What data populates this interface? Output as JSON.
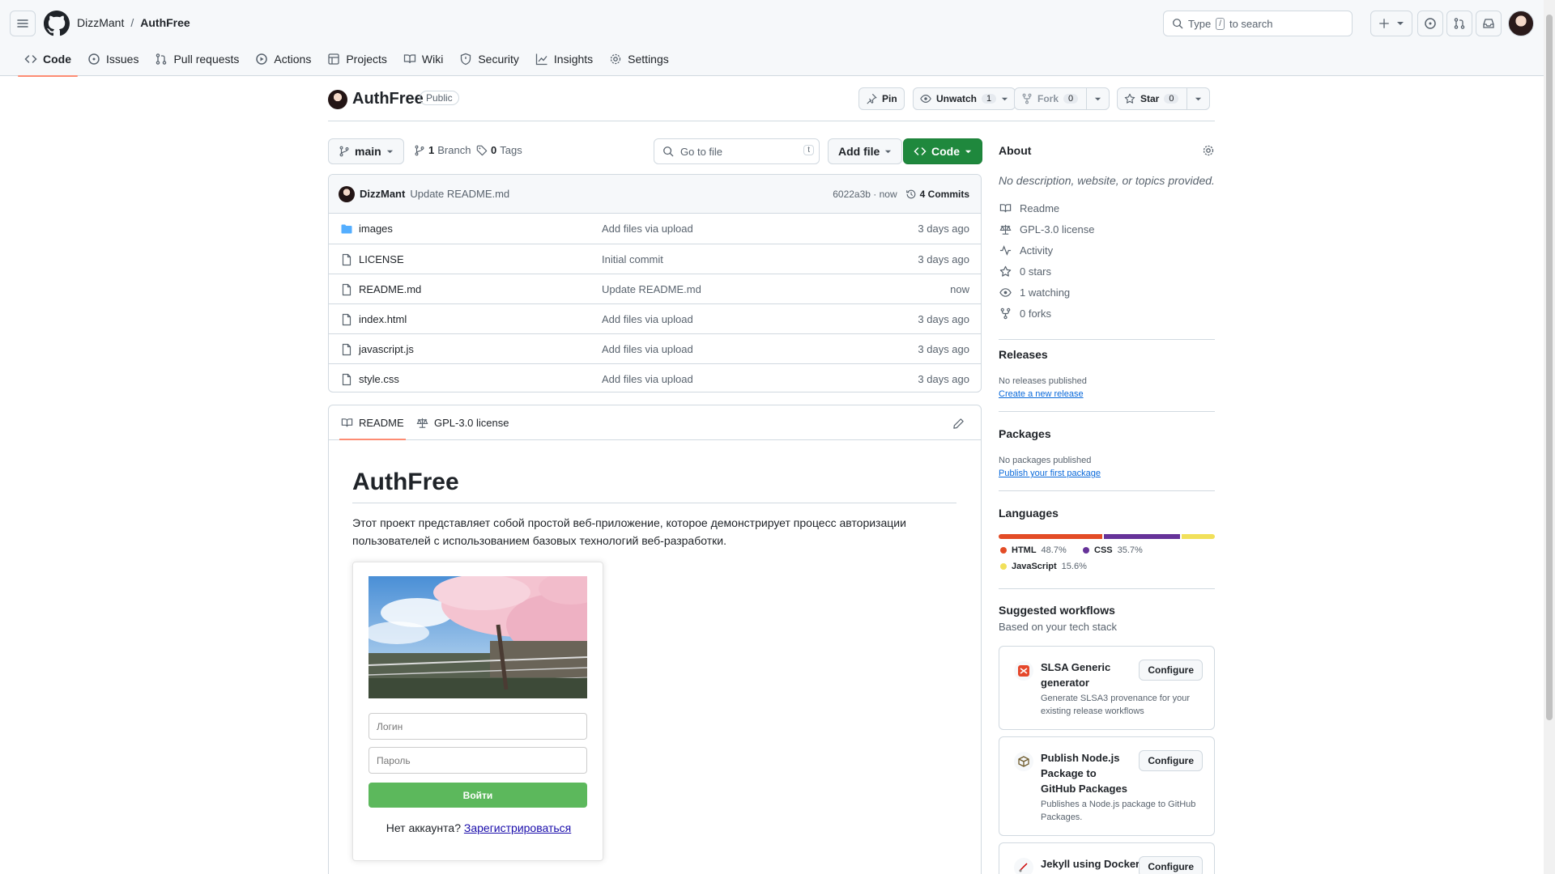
{
  "header": {
    "owner": "DizzMant",
    "separator": "/",
    "repo": "AuthFree",
    "search_prefix": "Type",
    "search_key": "/",
    "search_suffix": "to search"
  },
  "repo_tabs": [
    {
      "label": "Code",
      "icon": "code-icon"
    },
    {
      "label": "Issues",
      "icon": "issue-icon"
    },
    {
      "label": "Pull requests",
      "icon": "pull-request-icon"
    },
    {
      "label": "Actions",
      "icon": "play-icon"
    },
    {
      "label": "Projects",
      "icon": "table-icon"
    },
    {
      "label": "Wiki",
      "icon": "book-icon"
    },
    {
      "label": "Security",
      "icon": "shield-icon"
    },
    {
      "label": "Insights",
      "icon": "graph-icon"
    },
    {
      "label": "Settings",
      "icon": "gear-icon"
    }
  ],
  "repo_header": {
    "name": "AuthFree",
    "visibility": "Public",
    "pin": "Pin",
    "unwatch": "Unwatch",
    "watch_count": "1",
    "fork": "Fork",
    "fork_count": "0",
    "star": "Star",
    "star_count": "0"
  },
  "toolbar": {
    "branch": "main",
    "branches_count": "1",
    "branches_label": "Branch",
    "tags_count": "0",
    "tags_label": "Tags",
    "goto_placeholder": "Go to file",
    "goto_key": "t",
    "add_file": "Add file",
    "code": "Code"
  },
  "latest_commit": {
    "author": "DizzMant",
    "message": "Update README.md",
    "hash_time": "6022a3b · now",
    "commits": "4 Commits"
  },
  "files": [
    {
      "name": "images",
      "type": "folder",
      "message": "Add files via upload",
      "time": "3 days ago"
    },
    {
      "name": "LICENSE",
      "type": "file",
      "message": "Initial commit",
      "time": "3 days ago"
    },
    {
      "name": "README.md",
      "type": "file",
      "message": "Update README.md",
      "time": "now"
    },
    {
      "name": "index.html",
      "type": "file",
      "message": "Add files via upload",
      "time": "3 days ago"
    },
    {
      "name": "javascript.js",
      "type": "file",
      "message": "Add files via upload",
      "time": "3 days ago"
    },
    {
      "name": "style.css",
      "type": "file",
      "message": "Add files via upload",
      "time": "3 days ago"
    }
  ],
  "readme": {
    "tab_readme": "README",
    "tab_license": "GPL-3.0 license",
    "title": "AuthFree",
    "description": "Этот проект представляет собой простой веб-приложение, которое демонстрирует процесс авторизации пользователей с использованием базовых технологий веб-разработки.",
    "demo": {
      "login_placeholder": "Логин",
      "password_placeholder": "Пароль",
      "login_button": "Войти",
      "no_account": "Нет аккаунта?",
      "register_link": "Зарегистрироваться"
    }
  },
  "sidebar": {
    "about_title": "About",
    "about_desc": "No description, website, or topics provided.",
    "about_items": [
      {
        "label": "Readme",
        "icon": "book-icon"
      },
      {
        "label": "GPL-3.0 license",
        "icon": "law-icon"
      },
      {
        "label": "Activity",
        "icon": "pulse-icon"
      },
      {
        "label": "0 stars",
        "icon": "star-icon"
      },
      {
        "label": "1 watching",
        "icon": "eye-icon"
      },
      {
        "label": "0 forks",
        "icon": "fork-icon"
      }
    ],
    "releases_title": "Releases",
    "releases_none": "No releases published",
    "releases_link": "Create a new release",
    "packages_title": "Packages",
    "packages_none": "No packages published",
    "packages_link": "Publish your first package",
    "languages_title": "Languages",
    "languages": [
      {
        "name": "HTML",
        "percent": "48.7%",
        "value": 48.7,
        "color": "#e34c26"
      },
      {
        "name": "CSS",
        "percent": "35.7%",
        "value": 35.7,
        "color": "#663399"
      },
      {
        "name": "JavaScript",
        "percent": "15.6%",
        "value": 15.6,
        "color": "#f1e05a"
      }
    ],
    "workflows_title": "Suggested workflows",
    "workflows_subtitle": "Based on your tech stack",
    "workflows": [
      {
        "title": "SLSA Generic generator",
        "desc": "Generate SLSA3 provenance for your existing release workflows",
        "button": "Configure"
      },
      {
        "title": "Publish Node.js Package to GitHub Packages",
        "desc": "Publishes a Node.js package to GitHub Packages.",
        "button": "Configure"
      },
      {
        "title": "Jekyll using Docker",
        "desc": "",
        "button": "Configure"
      }
    ]
  }
}
